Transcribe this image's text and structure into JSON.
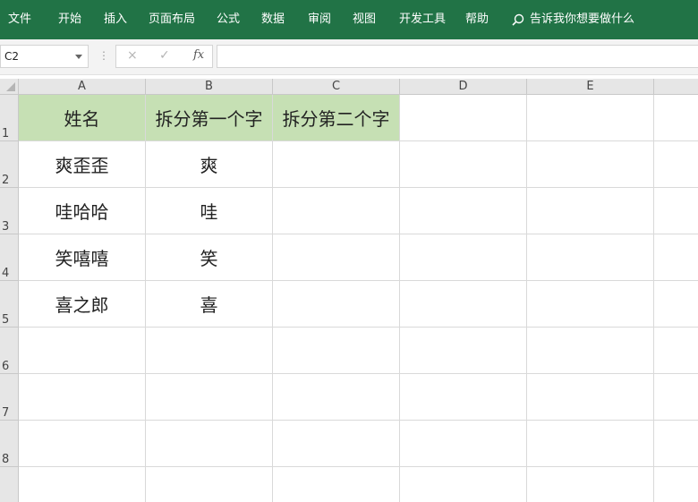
{
  "ribbon": {
    "tabs": [
      "文件",
      "开始",
      "插入",
      "页面布局",
      "公式",
      "数据",
      "审阅",
      "视图",
      "开发工具",
      "帮助"
    ],
    "tell_me": "告诉我你想要做什么",
    "search_icon": "search-icon",
    "bg_color": "#217346"
  },
  "formula_bar": {
    "name_box": "C2",
    "cancel_icon": "×",
    "enter_icon": "✓",
    "fx_label": "fx",
    "formula": ""
  },
  "grid": {
    "columns": [
      "A",
      "B",
      "C",
      "D",
      "E"
    ],
    "rows": [
      "1",
      "2",
      "3",
      "4",
      "5",
      "6",
      "7",
      "8"
    ],
    "header_fill": "#c6e0b4",
    "cells": [
      [
        "姓名",
        "拆分第一个字",
        "拆分第二个字",
        "",
        ""
      ],
      [
        "爽歪歪",
        "爽",
        "",
        "",
        ""
      ],
      [
        "哇哈哈",
        "哇",
        "",
        "",
        ""
      ],
      [
        "笑嘻嘻",
        "笑",
        "",
        "",
        ""
      ],
      [
        "喜之郎",
        "喜",
        "",
        "",
        ""
      ],
      [
        "",
        "",
        "",
        "",
        ""
      ],
      [
        "",
        "",
        "",
        "",
        ""
      ],
      [
        "",
        "",
        "",
        "",
        ""
      ]
    ]
  }
}
